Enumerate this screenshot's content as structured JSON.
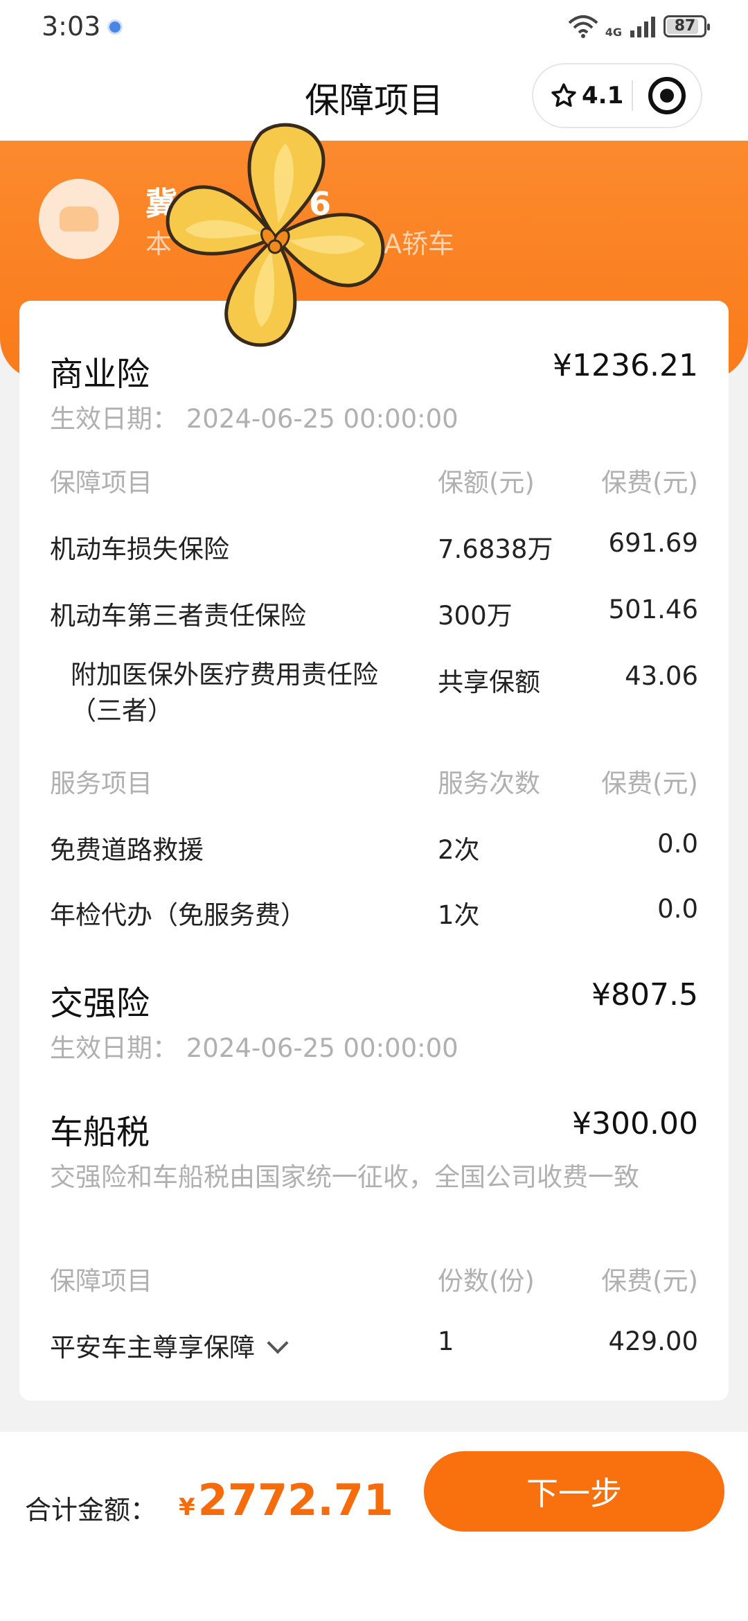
{
  "status_bar": {
    "time": "3:03",
    "network": "4G",
    "battery": "87",
    "battery_level": 0.87
  },
  "header": {
    "title": "保障项目",
    "rating": "4.1"
  },
  "vehicle": {
    "plate_visible": "冀",
    "plate_suffix": "6",
    "info_prefix": "本",
    "info_suffix": "A轿车"
  },
  "commercial": {
    "title": "商业险",
    "amount": "¥1236.21",
    "effective_date": "生效日期：  2024-06-25 00:00:00",
    "table_header": {
      "item": "保障项目",
      "coverage": "保额(元)",
      "premium": "保费(元)"
    },
    "items": [
      {
        "name": "机动车损失保险",
        "coverage": "7.6838万",
        "premium": "691.69"
      },
      {
        "name": "机动车第三者责任保险",
        "coverage": "300万",
        "premium": "501.46"
      },
      {
        "name": "附加医保外医疗费用责任险（三者）",
        "coverage": "共享保额",
        "premium": "43.06"
      }
    ],
    "service_header": {
      "item": "服务项目",
      "count": "服务次数",
      "premium": "保费(元)"
    },
    "services": [
      {
        "name": "免费道路救援",
        "count": "2次",
        "premium": "0.0"
      },
      {
        "name": "年检代办（免服务费）",
        "count": "1次",
        "premium": "0.0"
      }
    ]
  },
  "compulsory": {
    "title": "交强险",
    "amount": "¥807.5",
    "effective_date": "生效日期：  2024-06-25 00:00:00"
  },
  "vehicle_tax": {
    "title": "车船税",
    "amount": "¥300.00",
    "note": "交强险和车船税由国家统一征收，全国公司收费一致"
  },
  "extra": {
    "header": {
      "item": "保障项目",
      "count": "份数(份)",
      "premium": "保费(元)"
    },
    "items": [
      {
        "name": "平安车主尊享保障",
        "count": "1",
        "premium": "429.00"
      }
    ]
  },
  "footer": {
    "total_label": "合计金额：",
    "currency": "¥",
    "total": "2772.71",
    "next_label": "下一步"
  },
  "colors": {
    "accent": "#f9700f",
    "header_orange": "#fb8a2e",
    "muted": "#b0b0b0"
  }
}
